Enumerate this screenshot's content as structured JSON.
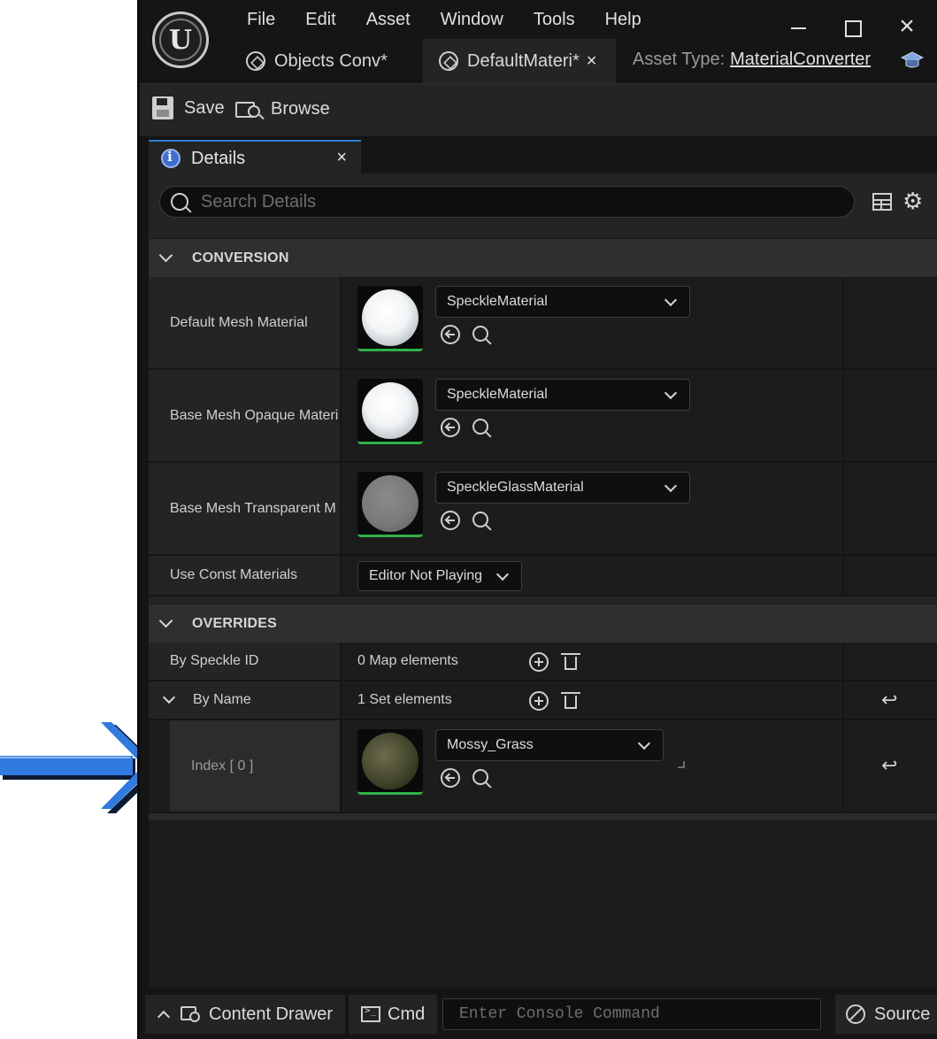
{
  "menu": [
    "File",
    "Edit",
    "Asset",
    "Window",
    "Tools",
    "Help"
  ],
  "tabs": [
    {
      "label": "Objects Conv",
      "dirty": "*"
    },
    {
      "label": "DefaultMateri",
      "dirty": "*",
      "close": "×"
    }
  ],
  "asset_type": {
    "label": "Asset Type:",
    "value": "MaterialConverter"
  },
  "window_controls": {
    "close": "×"
  },
  "toolbar": {
    "save_label": "Save",
    "browse_label": "Browse"
  },
  "details_tab": {
    "label": "Details",
    "close": "×"
  },
  "search": {
    "placeholder": "Search Details"
  },
  "gear": "⚙",
  "sections": {
    "conversion": {
      "title": "CONVERSION",
      "rows": [
        {
          "name": "Default Mesh Material",
          "value": "SpeckleMaterial"
        },
        {
          "name": "Base Mesh Opaque Materi",
          "value": "SpeckleMaterial"
        },
        {
          "name": "Base Mesh Transparent M",
          "value": "SpeckleGlassMaterial"
        },
        {
          "name": "Use Const Materials",
          "value": "Editor Not Playing"
        }
      ]
    },
    "overrides": {
      "title": "OVERRIDES",
      "by_speckle_id": {
        "name": "By Speckle ID",
        "count": "0 Map elements"
      },
      "by_name": {
        "name": "By Name",
        "count": "1 Set elements"
      },
      "index_row": {
        "name": "Index [ 0 ]",
        "value": "Mossy_Grass"
      }
    }
  },
  "reset_glyph": "↩",
  "statusbar": {
    "content_drawer": "Content Drawer",
    "cmd": "Cmd",
    "console_placeholder": "Enter Console Command",
    "source": "Source"
  },
  "colors": {
    "accent_blue": "#2a7fd6",
    "arrow_blue": "#2f7be0",
    "thumb_green": "#2fb24a"
  }
}
